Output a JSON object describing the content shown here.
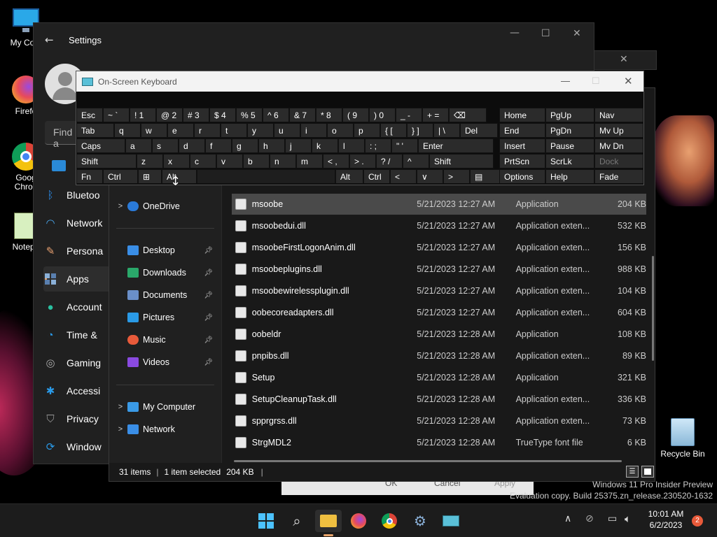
{
  "desktop": {
    "icons": [
      {
        "label": "My Com",
        "icon": "computer-icon"
      },
      {
        "label": "Firefo",
        "icon": "firefox-icon"
      },
      {
        "label": "Goog\nChron",
        "icon": "chrome-icon"
      },
      {
        "label": "Notepa",
        "icon": "notepad-icon"
      }
    ],
    "recycle_bin": "Recycle Bin"
  },
  "settings": {
    "title": "Settings",
    "search_placeholder": "Find a",
    "nav": [
      {
        "label": "Bluetoo",
        "icon": "bluetooth-icon"
      },
      {
        "label": "Network",
        "icon": "network-icon"
      },
      {
        "label": "Persona",
        "icon": "brush-icon"
      },
      {
        "label": "Apps",
        "icon": "apps-icon",
        "selected": true
      },
      {
        "label": "Account",
        "icon": "account-icon"
      },
      {
        "label": "Time &",
        "icon": "clock-icon"
      },
      {
        "label": "Gaming",
        "icon": "gamepad-icon"
      },
      {
        "label": "Accessi",
        "icon": "accessibility-icon"
      },
      {
        "label": "Privacy",
        "icon": "shield-icon"
      },
      {
        "label": "Window",
        "icon": "update-icon"
      }
    ]
  },
  "osk": {
    "title": "On-Screen Keyboard",
    "rows": [
      [
        "Esc",
        "~ `",
        "! 1",
        "@ 2",
        "# 3",
        "$ 4",
        "% 5",
        "^ 6",
        "& 7",
        "* 8",
        "( 9",
        ") 0",
        "_ -",
        "+ =",
        "⌫"
      ],
      [
        "Tab",
        "q",
        "w",
        "e",
        "r",
        "t",
        "y",
        "u",
        "i",
        "o",
        "p",
        "{ [",
        "} ]",
        "| \\",
        "Del"
      ],
      [
        "Caps",
        "a",
        "s",
        "d",
        "f",
        "g",
        "h",
        "j",
        "k",
        "l",
        ": ;",
        "\" '",
        "Enter"
      ],
      [
        "Shift",
        "z",
        "x",
        "c",
        "v",
        "b",
        "n",
        "m",
        "< ,",
        "> .",
        "? /",
        "^",
        "Shift"
      ],
      [
        "Fn",
        "Ctrl",
        "⊞",
        "Alt",
        "",
        "Alt",
        "Ctrl",
        "<",
        "∨",
        ">",
        "▤"
      ]
    ],
    "nav_keys": [
      [
        "Home",
        "PgUp",
        "Nav"
      ],
      [
        "End",
        "PgDn",
        "Mv Up"
      ],
      [
        "Insert",
        "Pause",
        "Mv Dn"
      ],
      [
        "PrtScn",
        "ScrLk",
        "Dock"
      ],
      [
        "Options",
        "Help",
        "Fade"
      ]
    ]
  },
  "explorer": {
    "tree": [
      {
        "label": "OneDrive",
        "chevron": true,
        "color": "#2a7ad8"
      },
      {
        "label": "Desktop",
        "pinned": true,
        "color": "#3a8ee6"
      },
      {
        "label": "Downloads",
        "pinned": true,
        "color": "#2aa86a"
      },
      {
        "label": "Documents",
        "pinned": true,
        "color": "#6a8fc8"
      },
      {
        "label": "Pictures",
        "pinned": true,
        "color": "#2a9ae6"
      },
      {
        "label": "Music",
        "pinned": true,
        "color": "#e85a3a"
      },
      {
        "label": "Videos",
        "pinned": true,
        "color": "#8a4ae0"
      },
      {
        "label": "My Computer",
        "chevron": true,
        "color": "#3a9ae6"
      },
      {
        "label": "Network",
        "chevron": true,
        "color": "#3a8ee6"
      }
    ],
    "files": [
      {
        "name": "msoobe",
        "date": "5/21/2023 12:27 AM",
        "type": "Application",
        "size": "204 KB",
        "selected": true
      },
      {
        "name": "msoobedui.dll",
        "date": "5/21/2023 12:27 AM",
        "type": "Application exten...",
        "size": "532 KB"
      },
      {
        "name": "msoobeFirstLogonAnim.dll",
        "date": "5/21/2023 12:27 AM",
        "type": "Application exten...",
        "size": "156 KB"
      },
      {
        "name": "msoobeplugins.dll",
        "date": "5/21/2023 12:27 AM",
        "type": "Application exten...",
        "size": "988 KB"
      },
      {
        "name": "msoobewirelessplugin.dll",
        "date": "5/21/2023 12:27 AM",
        "type": "Application exten...",
        "size": "104 KB"
      },
      {
        "name": "oobecoreadapters.dll",
        "date": "5/21/2023 12:27 AM",
        "type": "Application exten...",
        "size": "604 KB"
      },
      {
        "name": "oobeldr",
        "date": "5/21/2023 12:28 AM",
        "type": "Application",
        "size": "108 KB"
      },
      {
        "name": "pnpibs.dll",
        "date": "5/21/2023 12:28 AM",
        "type": "Application exten...",
        "size": "89 KB"
      },
      {
        "name": "Setup",
        "date": "5/21/2023 12:28 AM",
        "type": "Application",
        "size": "321 KB"
      },
      {
        "name": "SetupCleanupTask.dll",
        "date": "5/21/2023 12:28 AM",
        "type": "Application exten...",
        "size": "336 KB"
      },
      {
        "name": "spprgrss.dll",
        "date": "5/21/2023 12:28 AM",
        "type": "Application exten...",
        "size": "73 KB"
      },
      {
        "name": "StrgMDL2",
        "date": "5/21/2023 12:28 AM",
        "type": "TrueType font file",
        "size": "6 KB"
      }
    ],
    "status": {
      "items": "31 items",
      "selected": "1 item selected",
      "size": "204 KB"
    }
  },
  "dialog_buttons": [
    "OK",
    "Cancel",
    "Apply"
  ],
  "watermark": {
    "line1": "Windows 11 Pro Insider Preview",
    "line2": "Evaluation copy. Build 25375.zn_release.230520-1632"
  },
  "taskbar": {
    "time": "10:01 AM",
    "date": "6/2/2023",
    "notifications": "2"
  },
  "colors": {
    "accent": "#e8a36a",
    "selection": "#4a4a4a",
    "taskbar": "#1c1c1c"
  }
}
